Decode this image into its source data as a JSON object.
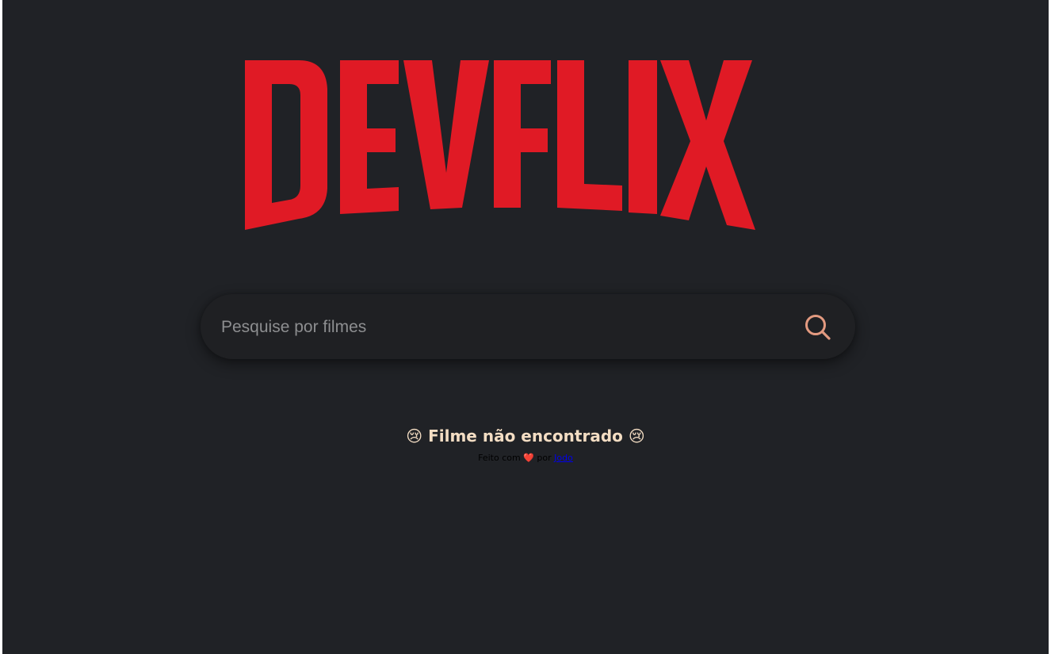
{
  "logo": {
    "text": "DEVFLIX",
    "color": "#e01a25"
  },
  "search": {
    "placeholder": "Pesquise por filmes",
    "value": "",
    "icon": "search-icon",
    "icon_color": "#e39a80"
  },
  "message": {
    "emoji": "😢",
    "text": "Filme não encontrado"
  },
  "footer": {
    "prefix": "Feito com",
    "heart": "❤️",
    "middle": "por",
    "author_link": "Jodo"
  },
  "colors": {
    "background": "#202226",
    "search_background": "#1f2023",
    "message_color": "#f3ddc3"
  }
}
